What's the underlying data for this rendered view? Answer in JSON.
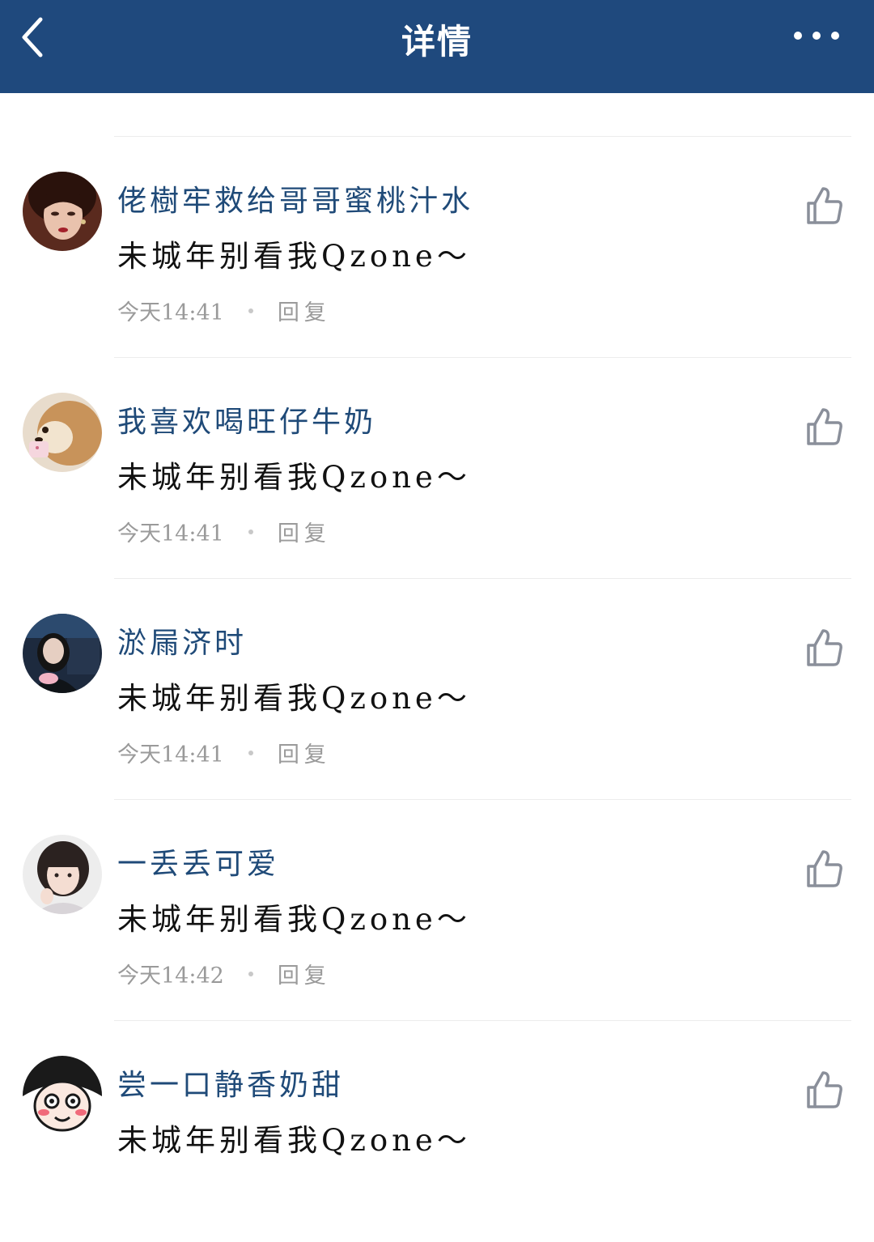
{
  "header": {
    "back_icon": "chevron-left-icon",
    "title": "详情",
    "more_icon": "more-dots-icon"
  },
  "colors": {
    "navbar": "#1f497d",
    "username": "#1f4a78",
    "comment": "#111111",
    "meta": "#9a9a9a",
    "like_icon": "#8a8f9a"
  },
  "comments": [
    {
      "username": "佬樹牢救给哥哥蜜桃汁水",
      "text": "未城年别看我Qzone～",
      "time": "今天14:41",
      "reply_label": "回复",
      "avatar_icon": "avatar-woman-portrait",
      "like_icon": "thumbs-up-icon"
    },
    {
      "username": "我喜欢喝旺仔牛奶",
      "text": "未城年别看我Qzone～",
      "time": "今天14:41",
      "reply_label": "回复",
      "avatar_icon": "avatar-shiba-dog",
      "like_icon": "thumbs-up-icon"
    },
    {
      "username": "淤屚济时",
      "text": "未城年别看我Qzone～",
      "time": "今天14:41",
      "reply_label": "回复",
      "avatar_icon": "avatar-girl-dark-room",
      "like_icon": "thumbs-up-icon"
    },
    {
      "username": "一丢丢可爱",
      "text": "未城年别看我Qzone～",
      "time": "今天14:42",
      "reply_label": "回复",
      "avatar_icon": "avatar-girl-bob-hair",
      "like_icon": "thumbs-up-icon"
    },
    {
      "username": "尝一口静香奶甜",
      "text": "未城年别看我Qzone～",
      "time": "",
      "reply_label": "",
      "avatar_icon": "avatar-cartoon-blush",
      "like_icon": "thumbs-up-icon"
    }
  ]
}
